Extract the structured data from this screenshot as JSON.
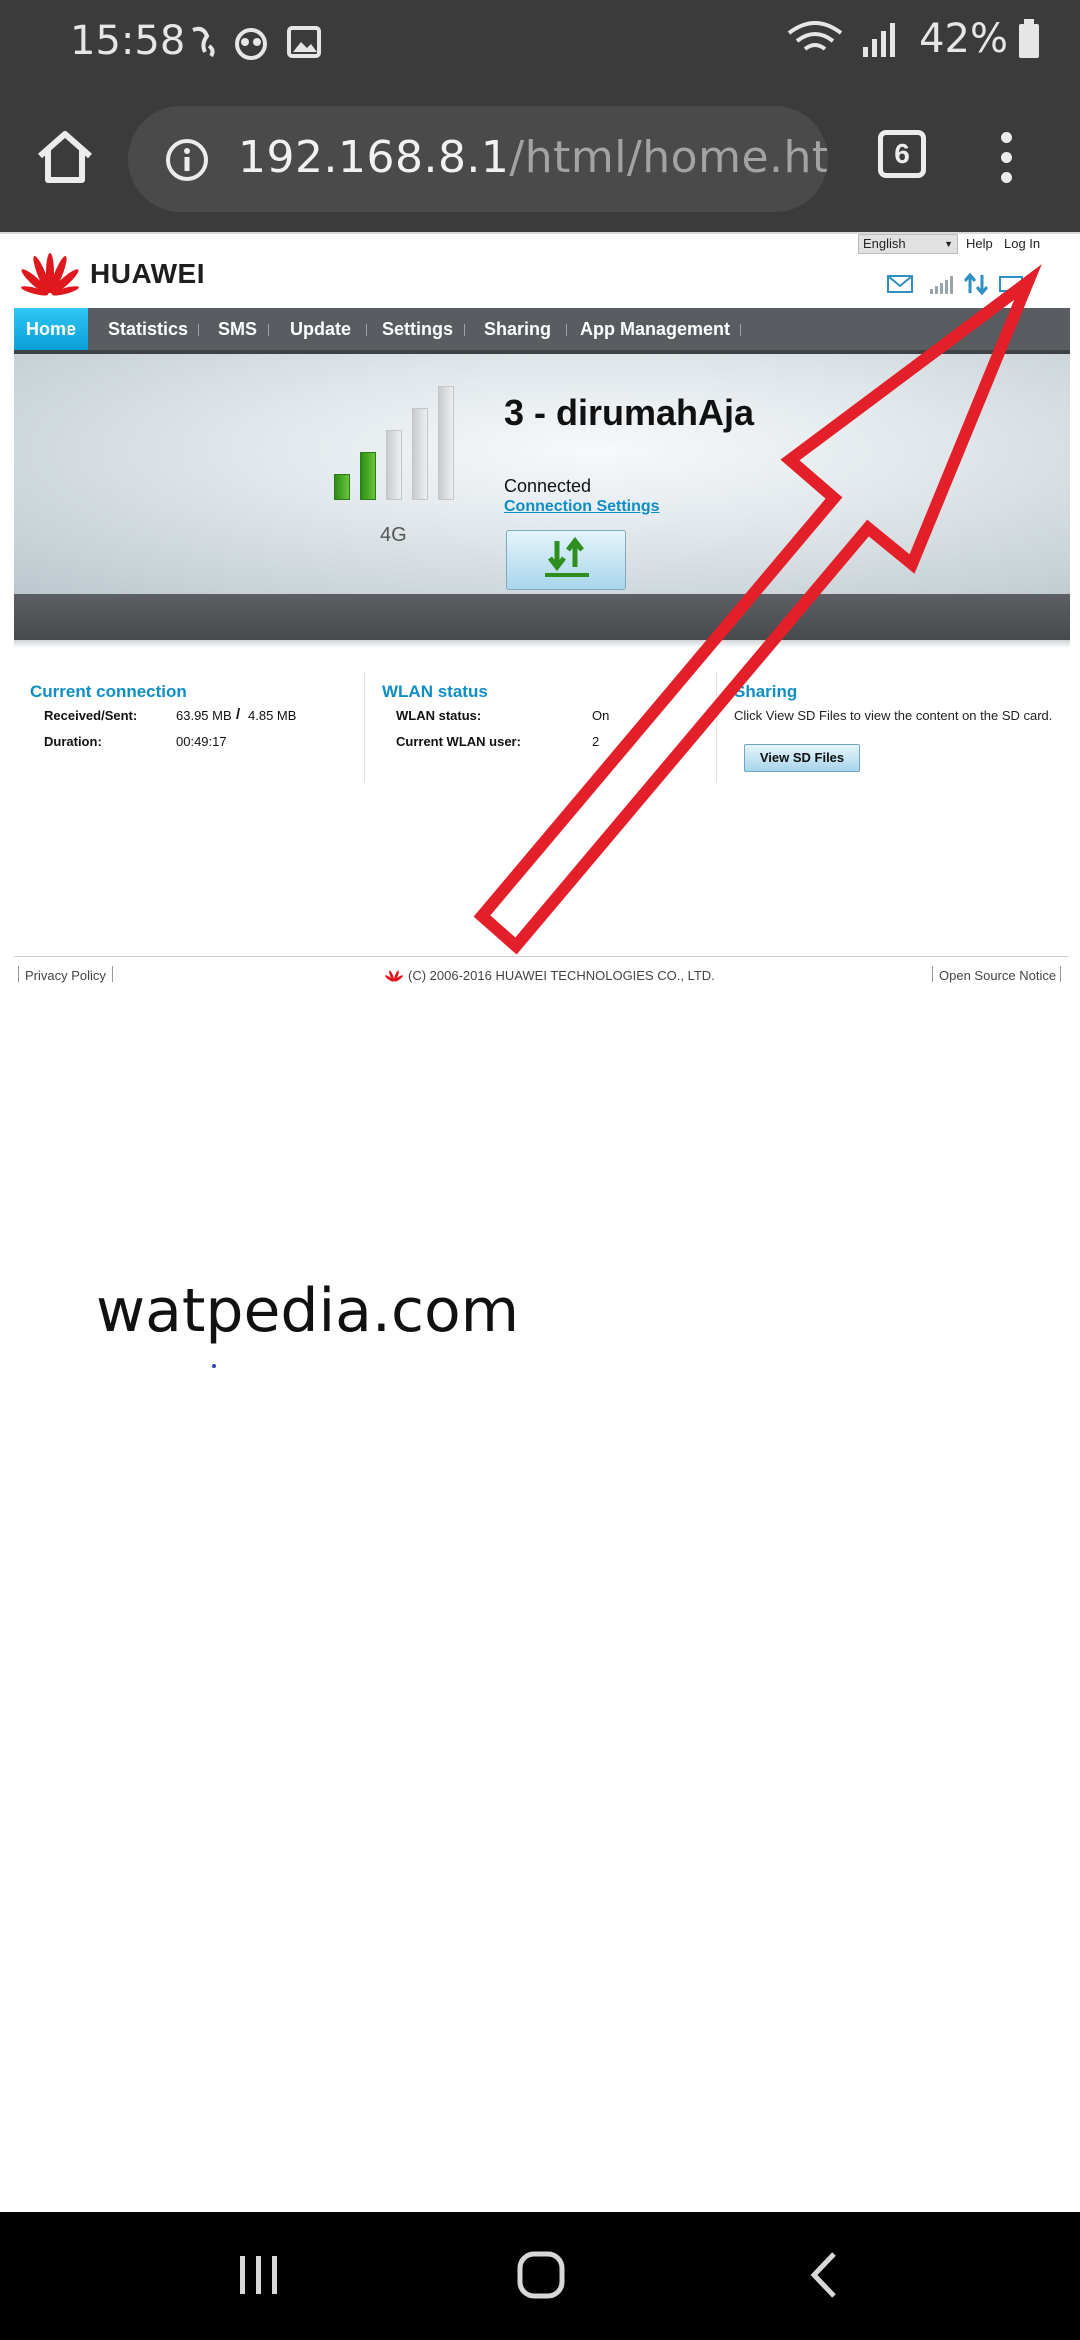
{
  "status_bar": {
    "time": "15:58",
    "battery_percent": "42%",
    "icons": [
      "notification-icon",
      "owl-icon",
      "gallery-icon",
      "wifi-icon",
      "signal-icon",
      "battery-icon"
    ]
  },
  "browser": {
    "url_host": "192.168.8.1",
    "url_path": "/html/home.htm",
    "tab_count": "6"
  },
  "router": {
    "language": "English",
    "help": "Help",
    "login": "Log In",
    "brand": "HUAWEI",
    "nav": [
      "Home",
      "Statistics",
      "SMS",
      "Update",
      "Settings",
      "Sharing",
      "App Management"
    ],
    "network_type": "4G",
    "network_name": "3 - dirumahAja",
    "connection_status": "Connected",
    "connection_settings": "Connection Settings",
    "signal_level_bars": 2,
    "signal_total_bars": 5,
    "current_connection": {
      "title": "Current connection",
      "received_sent_label": "Received/Sent:",
      "received": "63.95 MB",
      "separator": "/",
      "sent": "4.85 MB",
      "duration_label": "Duration:",
      "duration": "00:49:17"
    },
    "wlan": {
      "title": "WLAN status",
      "status_label": "WLAN status:",
      "status": "On",
      "users_label": "Current WLAN user:",
      "users": "2"
    },
    "sharing": {
      "title": "Sharing",
      "text": "Click View SD Files to view the content on the SD card.",
      "button": "View SD Files"
    },
    "footer": {
      "privacy": "Privacy Policy",
      "copyright": "(C) 2006-2016 HUAWEI TECHNOLOGIES CO., LTD.",
      "open_source": "Open Source Notice"
    }
  },
  "watermark": "watpedia.com",
  "colors": {
    "accent_blue": "#0e8ec4",
    "nav_active": "#18b4ea",
    "signal_green": "#3faa1a",
    "arrow_red": "#e3202a"
  }
}
